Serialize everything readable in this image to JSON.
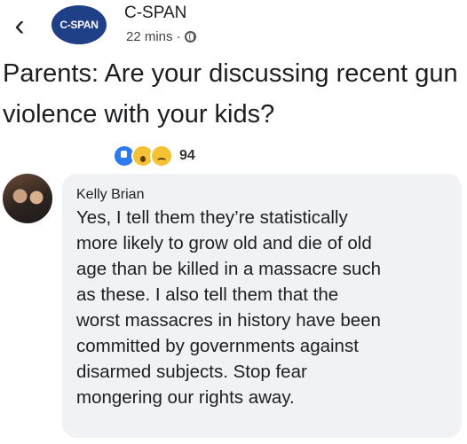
{
  "header": {
    "back_glyph": "‹",
    "page_avatar_text": "C-SPAN",
    "page_name": "C-SPAN",
    "post_time": "22 mins ·",
    "privacy_icon": "globe-icon"
  },
  "post": {
    "text": "Parents: Are your discussing recent gun violence with your kids?",
    "reactions": {
      "icons": [
        "like-icon",
        "wow-icon",
        "sad-icon"
      ],
      "count": "94"
    }
  },
  "comment": {
    "author": "Kelly Brian",
    "text": "Yes,  I tell them they’re statistically\nmore likely to grow old and die of old\nage than be killed in a massacre such\nas these.  I also tell them that the\nworst massacres in history have been\ncommitted by governments against\ndisarmed subjects.  Stop fear\nmongering our rights away."
  }
}
